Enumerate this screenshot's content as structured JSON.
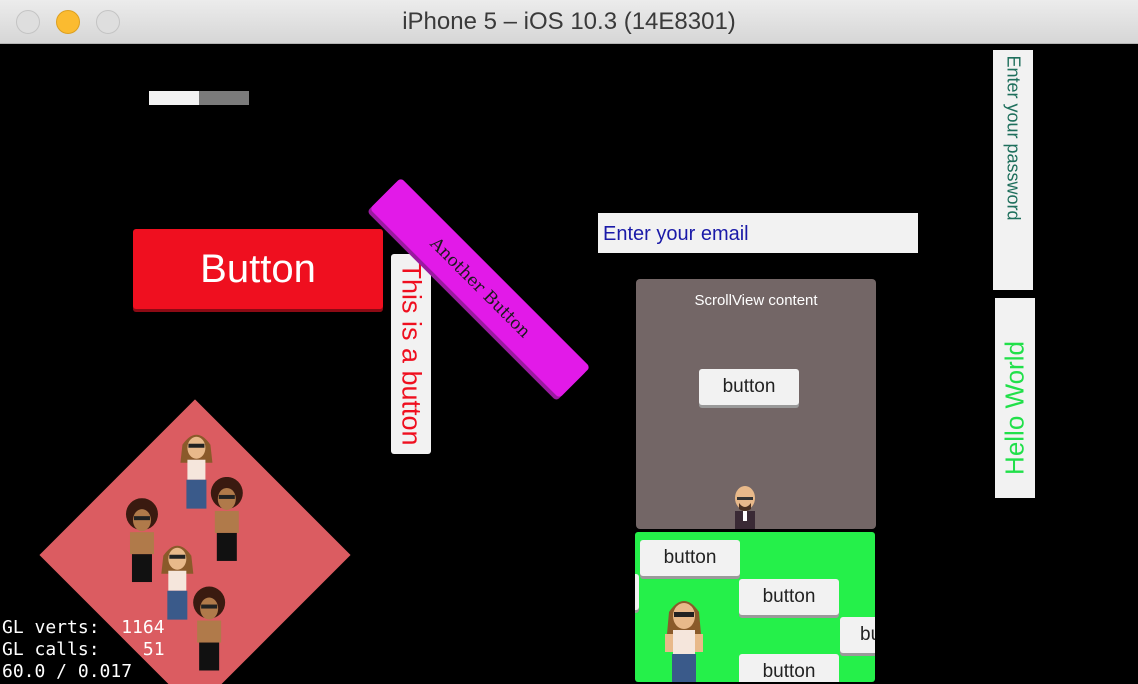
{
  "window": {
    "title": "iPhone 5 – iOS 10.3 (14E8301)"
  },
  "slider": {
    "value": 0.5
  },
  "buttons": {
    "main": "Button",
    "vertical": "This is a button",
    "diagonal": "Another Button"
  },
  "inputs": {
    "email_placeholder": "Enter your email",
    "password_placeholder": "Enter your password"
  },
  "labels": {
    "hello": "Hello World"
  },
  "scrollview": {
    "content_label": "ScrollView content",
    "button_label": "button"
  },
  "green_panel": {
    "buttons": [
      "button",
      "button",
      "bu",
      "button"
    ]
  },
  "stats": {
    "gl_verts": "GL verts:  1164",
    "gl_calls": "GL calls:    51",
    "fps": "60.0 / 0.017"
  },
  "colors": {
    "red": "#ef0f1f",
    "magenta": "#e21ae8",
    "green": "#25f04a",
    "scroll_bg": "#736666",
    "diamond_bg": "#db5c61"
  },
  "icons": [
    "bitmoji-woman-figure",
    "bitmoji-afro-man-figure",
    "bitmoji-bald-man-figure"
  ]
}
